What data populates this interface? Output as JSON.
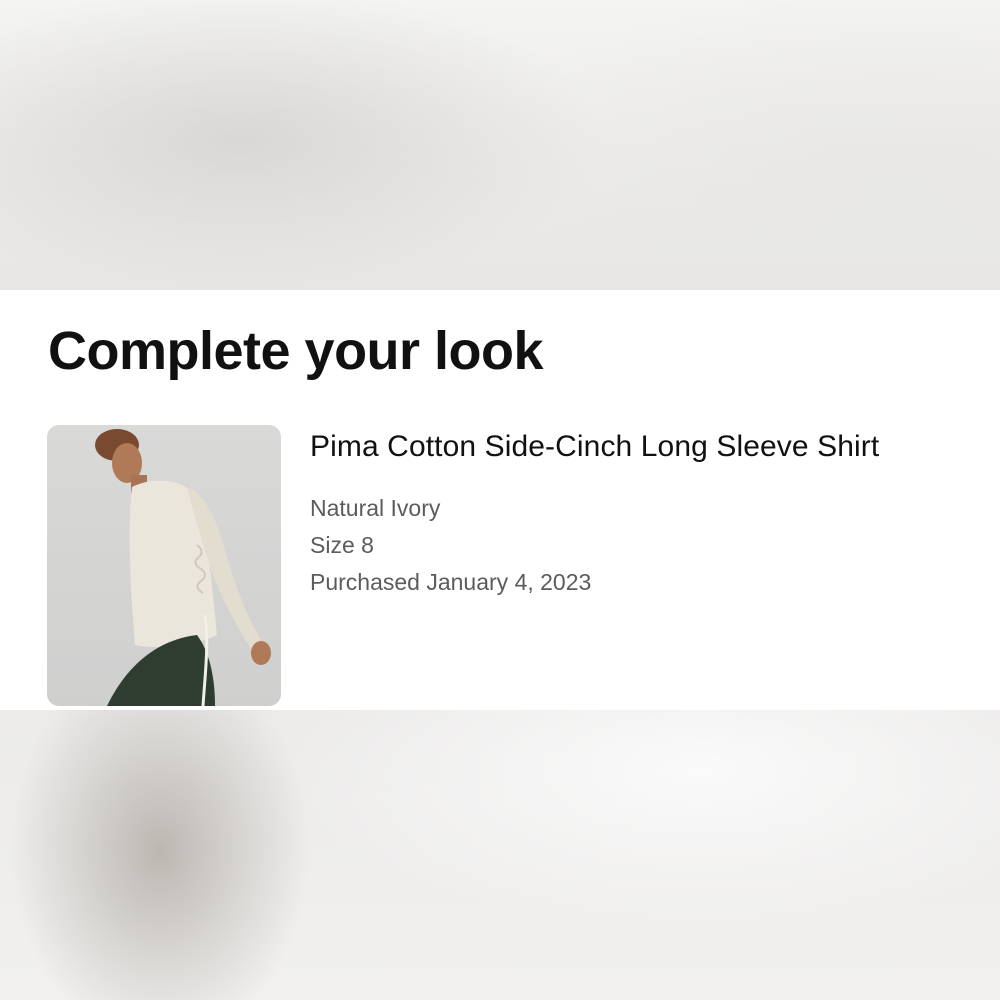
{
  "section": {
    "heading": "Complete your look"
  },
  "product": {
    "name": "Pima Cotton Side-Cinch Long Sleeve Shirt",
    "color": "Natural Ivory",
    "size": "Size 8",
    "purchased": "Purchased January 4, 2023",
    "image_icon": "product-photo"
  },
  "colors": {
    "heading_text": "#111111",
    "meta_text": "#5c5c5c",
    "shirt": "#ebe6db",
    "leggings": "#2f3d31"
  }
}
